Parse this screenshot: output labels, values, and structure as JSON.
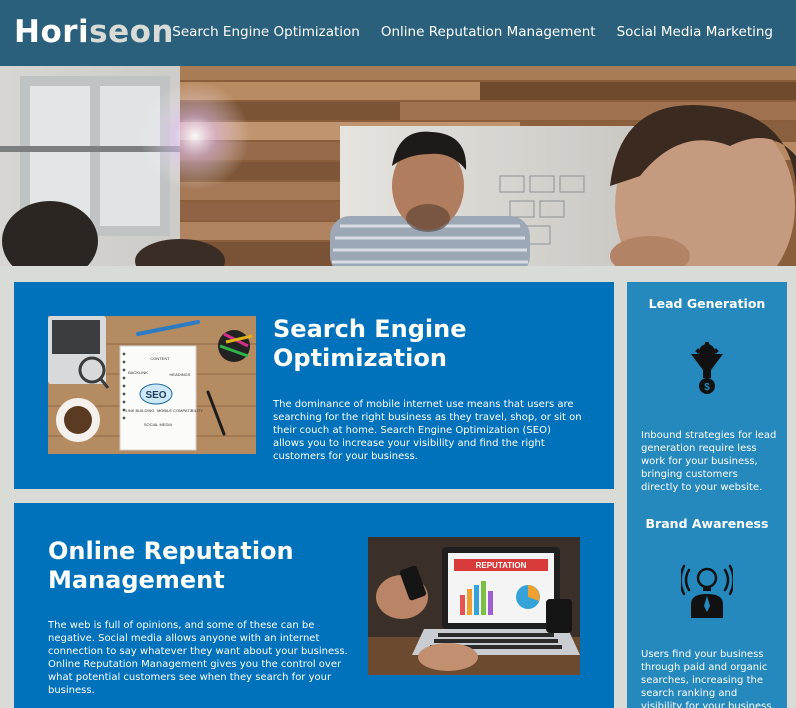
{
  "header": {
    "logo_main": "Hori",
    "logo_accent": "seon",
    "nav": [
      {
        "label": "Search Engine Optimization"
      },
      {
        "label": "Online Reputation Management"
      },
      {
        "label": "Social Media Marketing"
      }
    ]
  },
  "colors": {
    "header_bg": "#2a607c",
    "card_bg": "#0072bb",
    "aside_bg": "#2589bd",
    "page_bg": "#d9dcd6"
  },
  "seo": {
    "title": "Search Engine Optimization",
    "body": "The dominance of mobile internet use means that users are searching for the right business as they travel, shop, or sit on their couch at home. Search Engine Optimization (SEO) allows you to increase your visibility and find the right customers for your business.",
    "image_labels": [
      "SEO",
      "CONTENT",
      "BACKLINK",
      "HEADINGS",
      "LINK BUILDING",
      "MOBILE COMPATIBILITY",
      "SOCIAL MEDIA"
    ]
  },
  "orm": {
    "title": "Online Reputation Management",
    "body": "The web is full of opinions, and some of these can be negative. Social media allows anyone with an internet connection to say whatever they want about your business. Online Reputation Management gives you the control over what potential customers see when they search for your business.",
    "image_label": "REPUTATION"
  },
  "aside": {
    "lead": {
      "title": "Lead Generation",
      "icon": "funnel-dollar-icon",
      "body": "Inbound strategies for lead generation require less work for your business, bringing customers directly to your website."
    },
    "brand": {
      "title": "Brand Awareness",
      "icon": "lightbulb-person-icon",
      "body": "Users find your business through paid and organic searches, increasing the search ranking and visibility for your business."
    }
  }
}
